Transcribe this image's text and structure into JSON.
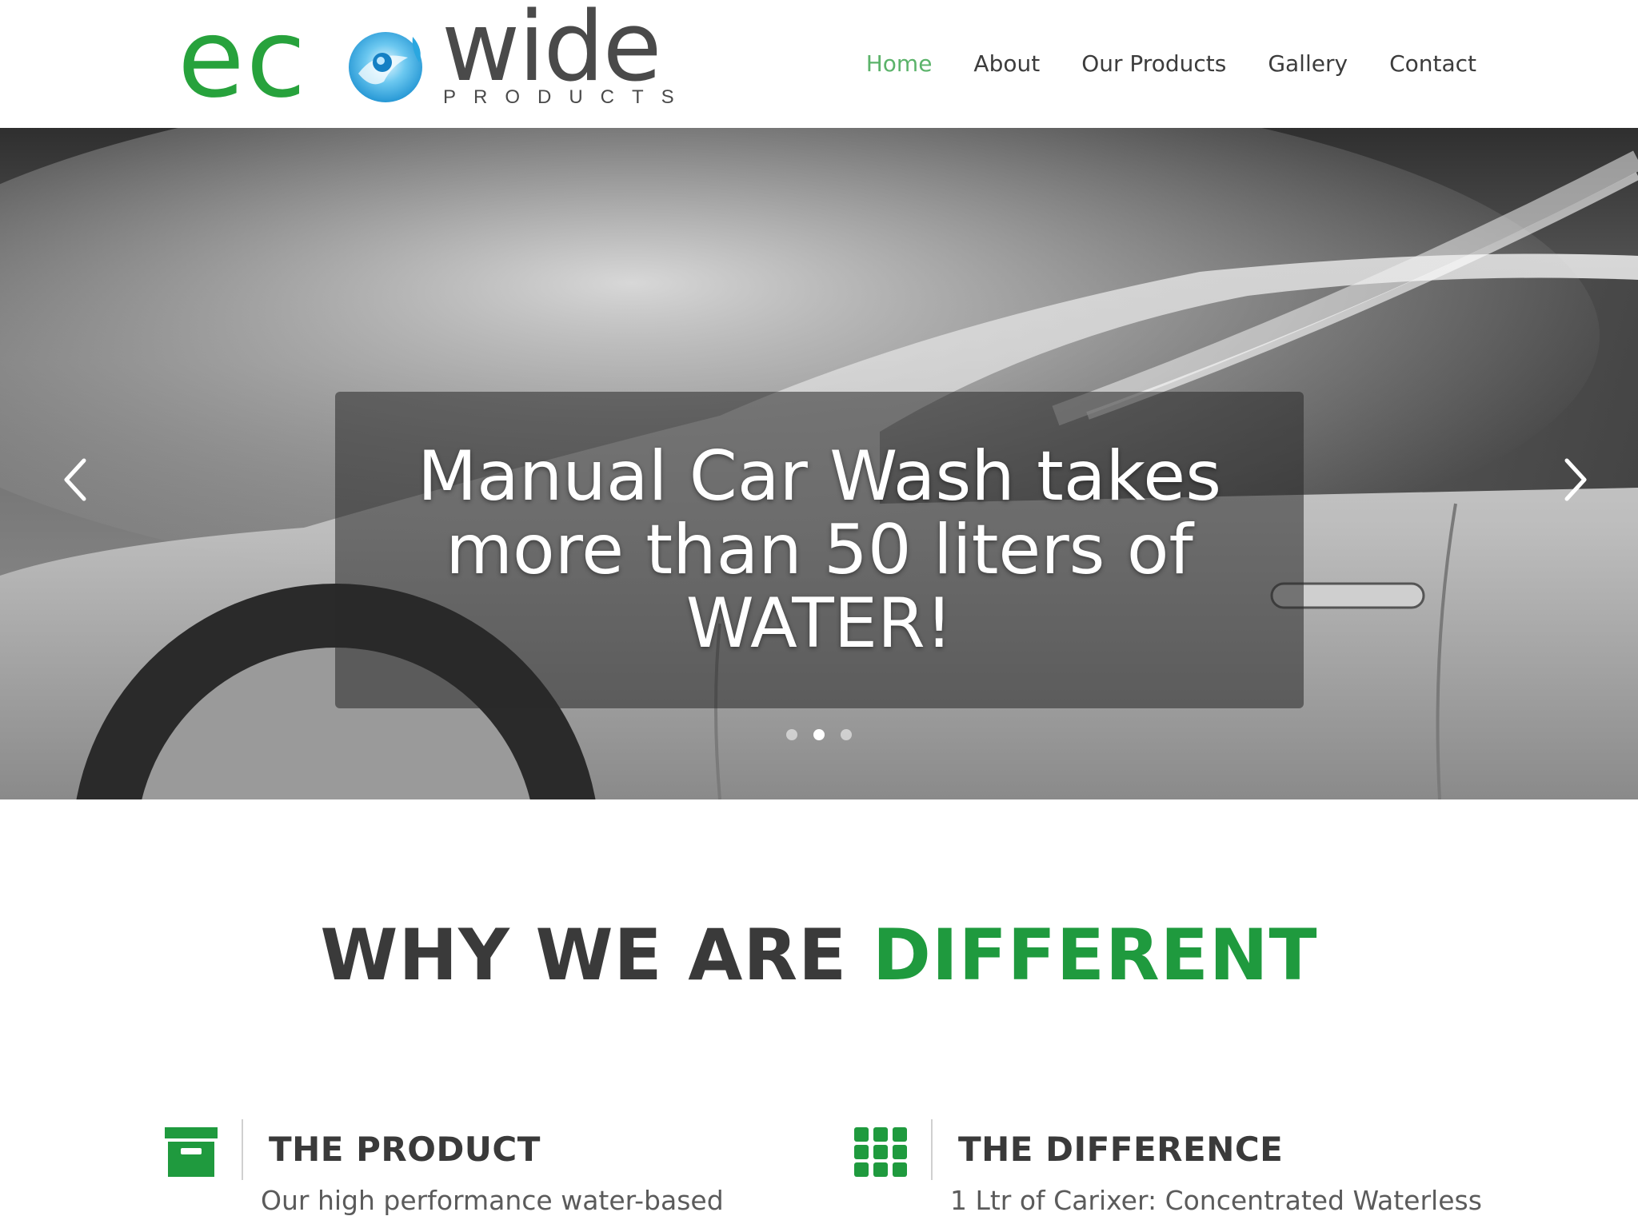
{
  "brand": {
    "logo_main": "ec",
    "logo_second": "wide",
    "logo_sub": "PRODUCTS",
    "green": "#27a23c",
    "blue": "#2aa7e0"
  },
  "nav": {
    "items": [
      {
        "label": "Home",
        "active": true
      },
      {
        "label": "About"
      },
      {
        "label": "Our Products"
      },
      {
        "label": "Gallery"
      },
      {
        "label": "Contact"
      }
    ]
  },
  "hero": {
    "caption": "Manual Car Wash takes more than 50 liters of WATER!",
    "slide_count": 3,
    "active_slide": 2,
    "prev_icon": "chevron-left-icon",
    "next_icon": "chevron-right-icon"
  },
  "section": {
    "title_prefix": "WHY WE ARE ",
    "title_accent": "DIFFERENT",
    "accent_color": "#1f9a3e"
  },
  "features": [
    {
      "icon": "archive-box-icon",
      "title": "THE PRODUCT",
      "text": "Our high performance water-based"
    },
    {
      "icon": "grid-icon",
      "title": "THE DIFFERENCE",
      "text": "1 Ltr of Carixer: Concentrated Waterless"
    }
  ]
}
